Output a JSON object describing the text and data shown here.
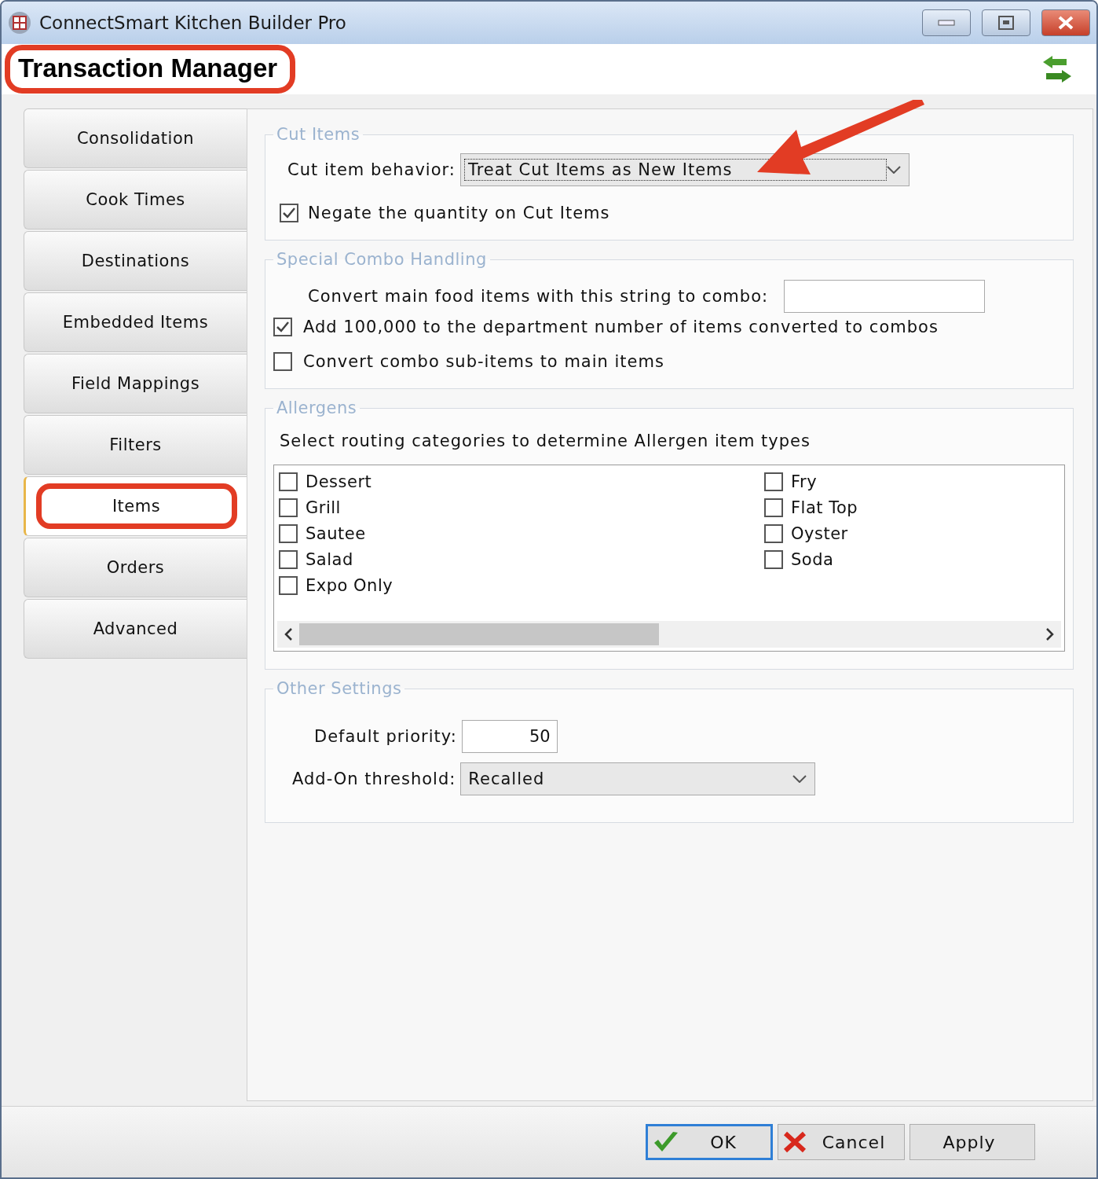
{
  "window": {
    "title": "ConnectSmart Kitchen Builder Pro"
  },
  "header": {
    "title": "Transaction Manager",
    "highlighted": true
  },
  "tabs": [
    {
      "label": "Consolidation",
      "selected": false,
      "highlighted": false
    },
    {
      "label": "Cook Times",
      "selected": false,
      "highlighted": false
    },
    {
      "label": "Destinations",
      "selected": false,
      "highlighted": false
    },
    {
      "label": "Embedded Items",
      "selected": false,
      "highlighted": false
    },
    {
      "label": "Field Mappings",
      "selected": false,
      "highlighted": false
    },
    {
      "label": "Filters",
      "selected": false,
      "highlighted": false
    },
    {
      "label": "Items",
      "selected": true,
      "highlighted": true
    },
    {
      "label": "Orders",
      "selected": false,
      "highlighted": false
    },
    {
      "label": "Advanced",
      "selected": false,
      "highlighted": false
    }
  ],
  "cut_items": {
    "title": "Cut Items",
    "behavior_label": "Cut item behavior:",
    "behavior_value": "Treat Cut Items as New Items",
    "negate": {
      "label": "Negate the quantity on Cut Items",
      "checked": true
    }
  },
  "combo": {
    "title": "Special Combo Handling",
    "convert_label": "Convert main food items with this string to combo:",
    "options": [
      {
        "label": "Add 100,000 to the department number of items converted to combos",
        "checked": true
      },
      {
        "label": "Convert combo sub-items to main items",
        "checked": false
      }
    ]
  },
  "allergens": {
    "title": "Allergens",
    "instruction": "Select routing categories to determine Allergen item types",
    "categories": [
      {
        "label": "Dessert",
        "checked": false
      },
      {
        "label": "Grill",
        "checked": false
      },
      {
        "label": "Sautee",
        "checked": false
      },
      {
        "label": "Salad",
        "checked": false
      },
      {
        "label": "Expo Only",
        "checked": false
      },
      {
        "label": "Fry",
        "checked": false
      },
      {
        "label": "Flat Top",
        "checked": false
      },
      {
        "label": "Oyster",
        "checked": false
      },
      {
        "label": "Soda",
        "checked": false
      }
    ]
  },
  "other": {
    "title": "Other Settings",
    "priority_label": "Default priority:",
    "priority_value": "50",
    "threshold_label": "Add-On threshold:",
    "threshold_value": "Recalled"
  },
  "buttons": [
    {
      "label": "OK",
      "kind": "ok",
      "focused": true
    },
    {
      "label": "Cancel",
      "kind": "cancel",
      "focused": false
    },
    {
      "label": "Apply",
      "kind": "apply",
      "focused": false
    }
  ]
}
